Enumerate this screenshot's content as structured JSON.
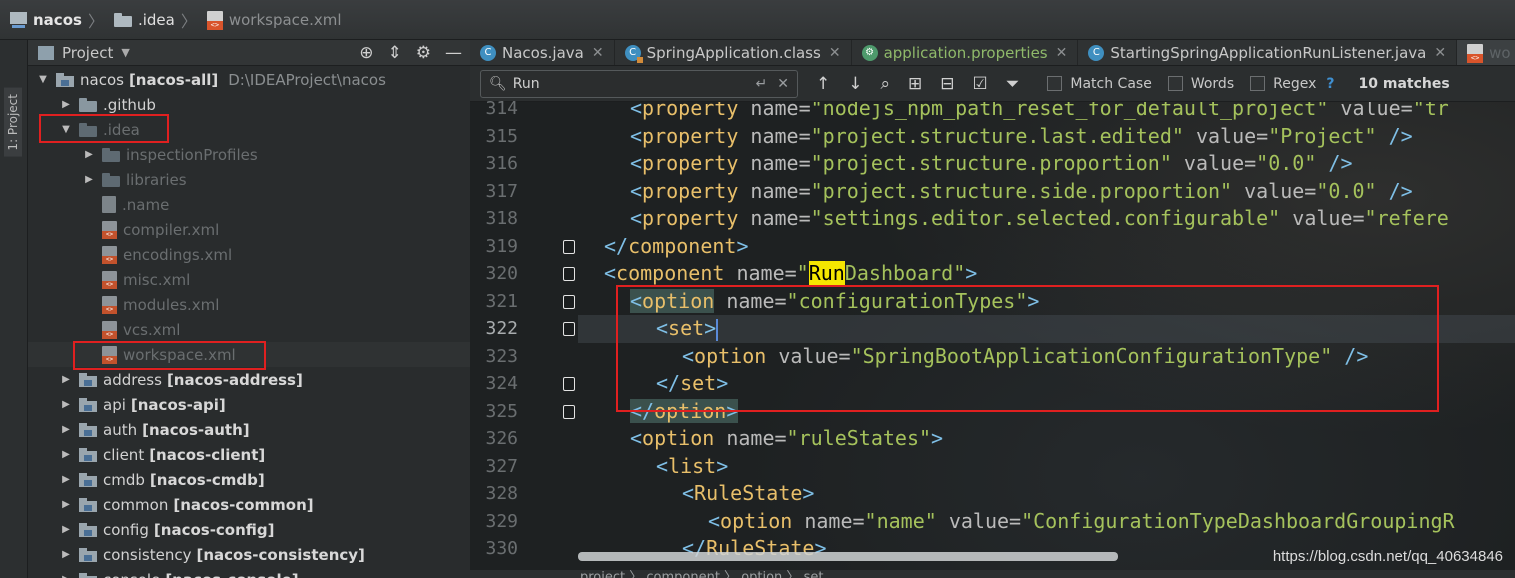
{
  "breadcrumb": {
    "items": [
      {
        "label": "nacos",
        "icon": "project-icon"
      },
      {
        "label": ".idea",
        "icon": "folder-icon"
      },
      {
        "label": "workspace.xml",
        "icon": "xml-file-icon"
      }
    ],
    "separator": "〉"
  },
  "toolstrip": {
    "project_label": "1: Project"
  },
  "project_panel": {
    "title": "Project",
    "tree": [
      {
        "label": "nacos",
        "module": "[nacos-all]",
        "path": "D:\\IDEAProject\\nacos",
        "level": 0,
        "expanded": true,
        "kind": "module"
      },
      {
        "label": ".github",
        "level": 1,
        "expanded": false,
        "kind": "folder"
      },
      {
        "label": ".idea",
        "level": 1,
        "expanded": true,
        "kind": "folder-dim"
      },
      {
        "label": "inspectionProfiles",
        "level": 2,
        "expanded": false,
        "kind": "folder-dim"
      },
      {
        "label": "libraries",
        "level": 2,
        "expanded": false,
        "kind": "folder-dim"
      },
      {
        "label": ".name",
        "level": 2,
        "kind": "file"
      },
      {
        "label": "compiler.xml",
        "level": 2,
        "kind": "xml"
      },
      {
        "label": "encodings.xml",
        "level": 2,
        "kind": "xml"
      },
      {
        "label": "misc.xml",
        "level": 2,
        "kind": "xml"
      },
      {
        "label": "modules.xml",
        "level": 2,
        "kind": "xml"
      },
      {
        "label": "vcs.xml",
        "level": 2,
        "kind": "xml"
      },
      {
        "label": "workspace.xml",
        "level": 2,
        "kind": "xml",
        "selected": true
      },
      {
        "label": "address",
        "module": "[nacos-address]",
        "level": 1,
        "expanded": false,
        "kind": "module"
      },
      {
        "label": "api",
        "module": "[nacos-api]",
        "level": 1,
        "expanded": false,
        "kind": "module"
      },
      {
        "label": "auth",
        "module": "[nacos-auth]",
        "level": 1,
        "expanded": false,
        "kind": "module"
      },
      {
        "label": "client",
        "module": "[nacos-client]",
        "level": 1,
        "expanded": false,
        "kind": "module"
      },
      {
        "label": "cmdb",
        "module": "[nacos-cmdb]",
        "level": 1,
        "expanded": false,
        "kind": "module"
      },
      {
        "label": "common",
        "module": "[nacos-common]",
        "level": 1,
        "expanded": false,
        "kind": "module"
      },
      {
        "label": "config",
        "module": "[nacos-config]",
        "level": 1,
        "expanded": false,
        "kind": "module"
      },
      {
        "label": "consistency",
        "module": "[nacos-consistency]",
        "level": 1,
        "expanded": false,
        "kind": "module"
      },
      {
        "label": "console",
        "module": "[nacos-console]",
        "level": 1,
        "expanded": false,
        "kind": "module"
      }
    ]
  },
  "tabs": [
    {
      "label": "Nacos.java",
      "icon": "java-class-icon",
      "closable": true
    },
    {
      "label": "SpringApplication.class",
      "icon": "class-file-icon",
      "closable": true
    },
    {
      "label": "application.properties",
      "icon": "properties-icon",
      "closable": true
    },
    {
      "label": "StartingSpringApplicationRunListener.java",
      "icon": "java-class-icon",
      "closable": true
    },
    {
      "label": "wo",
      "icon": "xml-file-icon",
      "active": true
    }
  ],
  "find": {
    "query": "Run",
    "match_case_label": "Match Case",
    "words_label": "Words",
    "regex_label": "Regex",
    "help_label": "?",
    "matches_label": "10 matches"
  },
  "editor": {
    "lines": [
      {
        "n": "314"
      },
      {
        "n": "315"
      },
      {
        "n": "316"
      },
      {
        "n": "317"
      },
      {
        "n": "318"
      },
      {
        "n": "319"
      },
      {
        "n": "320"
      },
      {
        "n": "321"
      },
      {
        "n": "322"
      },
      {
        "n": "323"
      },
      {
        "n": "324"
      },
      {
        "n": "325"
      },
      {
        "n": "326"
      },
      {
        "n": "327"
      },
      {
        "n": "328"
      },
      {
        "n": "329"
      },
      {
        "n": "330"
      }
    ],
    "code": {
      "l314": [
        "<",
        "property",
        " name=",
        "\"nodejs_npm_path_reset_for_default_project\"",
        " value=",
        "\"tr"
      ],
      "l315": [
        "<",
        "property",
        " name=",
        "\"project.structure.last.edited\"",
        " value=",
        "\"Project\"",
        " />"
      ],
      "l316": [
        "<",
        "property",
        " name=",
        "\"project.structure.proportion\"",
        " value=",
        "\"0.0\"",
        " />"
      ],
      "l317": [
        "<",
        "property",
        " name=",
        "\"project.structure.side.proportion\"",
        " value=",
        "\"0.0\"",
        " />"
      ],
      "l318": [
        "<",
        "property",
        " name=",
        "\"settings.editor.selected.configurable\"",
        " value=",
        "\"refere"
      ],
      "l319": [
        "</",
        "component",
        ">"
      ],
      "l320": [
        "<",
        "component",
        " name=",
        "\"",
        "Run",
        "Dashboard\"",
        ">"
      ],
      "l321": [
        "<",
        "option",
        " name=",
        "\"configurationTypes\"",
        ">"
      ],
      "l322": [
        "<",
        "set",
        ">"
      ],
      "l323": [
        "<",
        "option",
        " value=",
        "\"SpringBootApplicationConfigurationType\"",
        " />"
      ],
      "l324": [
        "</",
        "set",
        ">"
      ],
      "l325": [
        "</",
        "option",
        ">"
      ],
      "l326": [
        "<",
        "option",
        " name=",
        "\"ruleStates\"",
        ">"
      ],
      "l327": [
        "<",
        "list",
        ">"
      ],
      "l328": [
        "<",
        "RuleState",
        ">"
      ],
      "l329": [
        "<",
        "option",
        " name=",
        "\"name\"",
        " value=",
        "\"ConfigurationTypeDashboardGroupingR"
      ],
      "l330": [
        "</",
        "RuleState",
        ">"
      ]
    },
    "bottom_crumbs": "project 〉 component 〉 option 〉 set"
  },
  "watermark": "https://blog.csdn.net/qq_40634846",
  "colors": {
    "tag": "#e8bf6a",
    "value": "#a5c25c",
    "bracket": "#7fbfe6",
    "search_highlight": "#f5e600",
    "annotation_box": "#e02020"
  }
}
